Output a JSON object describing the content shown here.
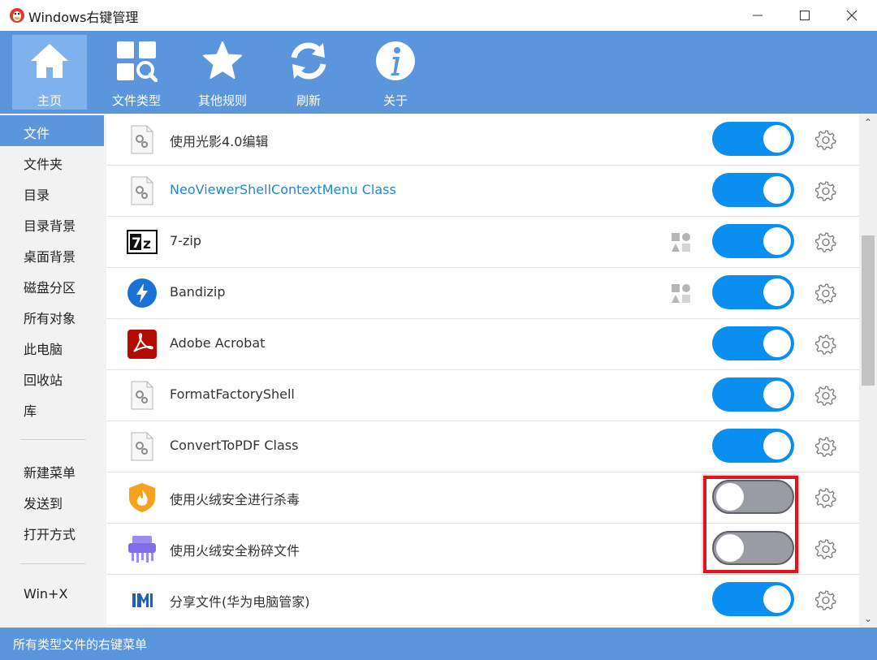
{
  "window": {
    "title": "Windows右键管理"
  },
  "toolbar": {
    "items": [
      {
        "label": "主页",
        "icon": "home-icon",
        "active": true
      },
      {
        "label": "文件类型",
        "icon": "file-type-search-icon"
      },
      {
        "label": "其他规则",
        "icon": "star-icon"
      },
      {
        "label": "刷新",
        "icon": "refresh-icon"
      },
      {
        "label": "关于",
        "icon": "info-icon"
      }
    ]
  },
  "sidebar": {
    "items": [
      {
        "label": "文件",
        "active": true
      },
      {
        "label": "文件夹"
      },
      {
        "label": "目录"
      },
      {
        "label": "目录背景"
      },
      {
        "label": "桌面背景"
      },
      {
        "label": "磁盘分区"
      },
      {
        "label": "所有对象"
      },
      {
        "label": "此电脑"
      },
      {
        "label": "回收站"
      },
      {
        "label": "库"
      },
      {
        "label": "新建菜单"
      },
      {
        "label": "发送到"
      },
      {
        "label": "打开方式"
      },
      {
        "label": "Win+X"
      }
    ]
  },
  "entries": [
    {
      "label": "使用光影4.0编辑",
      "icon": "generic-shell-icon",
      "enabled": true
    },
    {
      "label": "NeoViewerShellContextMenu Class",
      "icon": "generic-shell-icon",
      "enabled": true
    },
    {
      "label": "7-zip",
      "icon": "7zip-icon",
      "enabled": true
    },
    {
      "label": "Bandizip",
      "icon": "bandizip-icon",
      "enabled": true
    },
    {
      "label": "Adobe Acrobat",
      "icon": "adobe-acrobat-icon",
      "enabled": true
    },
    {
      "label": "FormatFactoryShell",
      "icon": "generic-shell-icon",
      "enabled": true
    },
    {
      "label": "ConvertToPDF Class",
      "icon": "generic-shell-icon",
      "enabled": true
    },
    {
      "label": "使用火绒安全进行杀毒",
      "icon": "huorong-shield-icon",
      "enabled": false
    },
    {
      "label": "使用火绒安全粉碎文件",
      "icon": "shredder-icon",
      "enabled": false
    },
    {
      "label": "分享文件(华为电脑管家)",
      "icon": "huawei-share-icon",
      "enabled": true
    }
  ],
  "statusbar": {
    "text": "所有类型文件的右键菜单"
  },
  "colors": {
    "accent": "#5b95dc",
    "toggle_on": "#0a8ef0",
    "toggle_off": "#9a9ca3",
    "highlight": "#e0141e"
  }
}
